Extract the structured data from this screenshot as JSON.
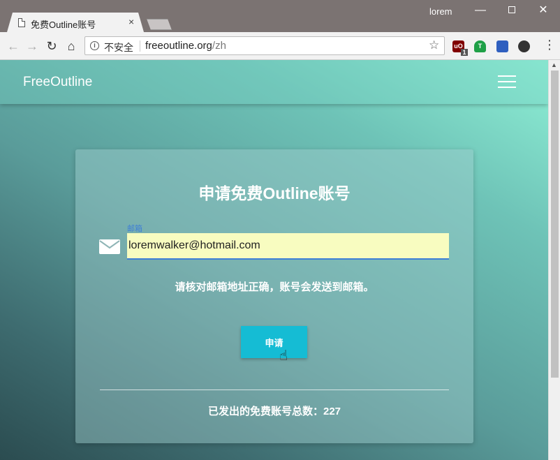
{
  "window": {
    "tab_title": "免费Outline账号",
    "tab_close": "×",
    "user": "lorem",
    "minimize": "—",
    "close": "✕"
  },
  "toolbar": {
    "back": "←",
    "forward": "→",
    "reload": "↻",
    "home": "⌂",
    "security_info": "i",
    "security_label": "不安全",
    "url_host": "freeoutline.org",
    "url_path": "/zh",
    "bookmark_star": "☆",
    "ublock_text": "uO",
    "ublock_badge": "1",
    "ext_t_text": "T",
    "menu": "⋮"
  },
  "page": {
    "brand": "FreeOutline",
    "title": "申请免费Outline账号",
    "email_label": "邮箱",
    "email_value": "loremwalker@hotmail.com",
    "hint": "请核对邮箱地址正确，账号会发送到邮箱。",
    "apply_label": "申请",
    "count_text": "已发出的免费账号总数：227"
  },
  "colors": {
    "accent": "#15bcd4",
    "input_bg": "#f8fcc0",
    "focus": "#3f7fd6"
  }
}
